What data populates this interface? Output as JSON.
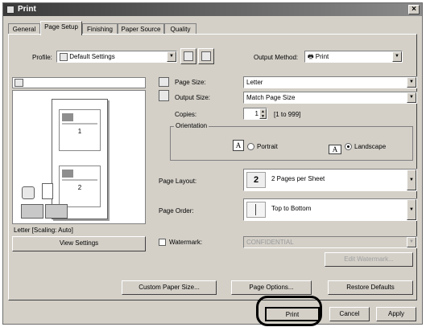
{
  "window": {
    "title": "Print",
    "close_glyph": "×"
  },
  "tabs": [
    {
      "label": "General"
    },
    {
      "label": "Page Setup"
    },
    {
      "label": "Finishing"
    },
    {
      "label": "Paper Source"
    },
    {
      "label": "Quality"
    }
  ],
  "profile": {
    "label": "Profile:",
    "value": "Default Settings"
  },
  "output_method": {
    "label": "Output Method:",
    "value": "Print"
  },
  "page_size": {
    "label": "Page Size:",
    "value": "Letter"
  },
  "output_size": {
    "label": "Output Size:",
    "value": "Match Page Size"
  },
  "copies": {
    "label": "Copies:",
    "value": "1",
    "range": "[1 to 999]"
  },
  "orientation": {
    "label": "Orientation",
    "portrait": "Portrait",
    "landscape": "Landscape",
    "selected": "landscape",
    "portrait_glyph": "A",
    "landscape_glyph": "A"
  },
  "page_layout": {
    "label": "Page Layout:",
    "value": "2 Pages per Sheet",
    "icon_glyph": "2"
  },
  "page_order": {
    "label": "Page Order:",
    "value": "Top to Bottom"
  },
  "watermark": {
    "label": "Watermark:",
    "value": "CONFIDENTIAL",
    "checked": false,
    "edit_button": "Edit Watermark..."
  },
  "preview": {
    "pages": [
      "1",
      "2"
    ],
    "caption": "Letter [Scaling: Auto]",
    "view_settings": "View Settings"
  },
  "buttons": {
    "custom_paper": "Custom Paper Size...",
    "page_options": "Page Options...",
    "restore": "Restore Defaults",
    "print": "Print",
    "cancel": "Cancel",
    "apply": "Apply"
  }
}
